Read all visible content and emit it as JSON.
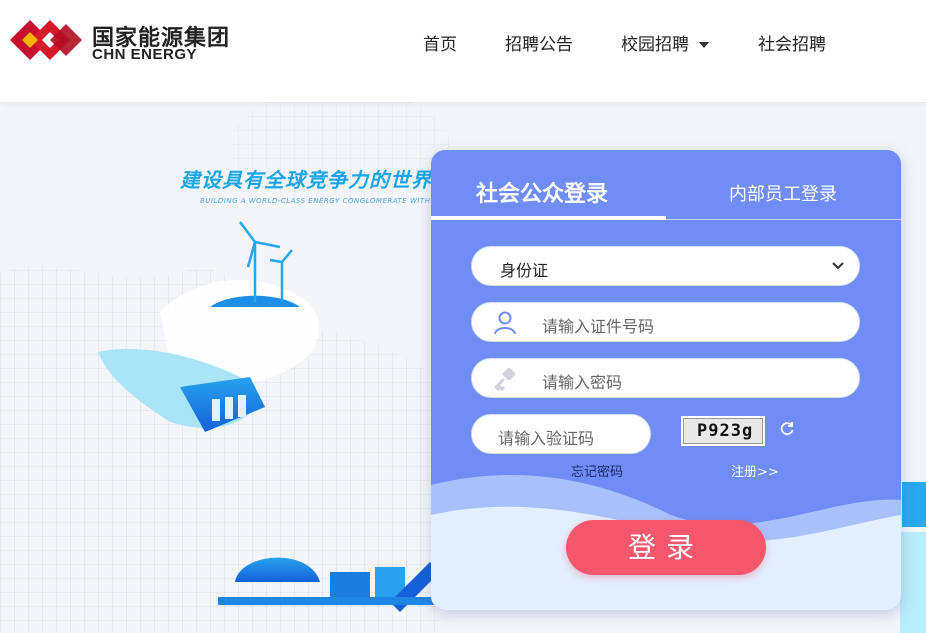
{
  "brand": {
    "name_cn": "国家能源集团",
    "name_en": "CHN ENERGY",
    "colors": {
      "primary_red": "#c8102e"
    }
  },
  "nav": {
    "items": [
      {
        "label": "首页"
      },
      {
        "label": "招聘公告"
      },
      {
        "label": "校园招聘",
        "has_dropdown": true
      },
      {
        "label": "社会招聘"
      }
    ]
  },
  "banner": {
    "slogan_cn": "建设具有全球竞争力的世界一流能",
    "slogan_en": "BUILDING A WORLD-CLASS ENERGY CONGLOMERATE WITH GLOBAL REA"
  },
  "login": {
    "tabs": [
      {
        "label": "社会公众登录",
        "active": true
      },
      {
        "label": "内部员工登录",
        "active": false
      }
    ],
    "id_type": {
      "selected": "身份证"
    },
    "id_number": {
      "placeholder": "请输入证件号码",
      "icon": "user-icon"
    },
    "password": {
      "placeholder": "请输入密码",
      "icon": "key-icon"
    },
    "captcha": {
      "placeholder": "请输入验证码",
      "image_text": "P923g"
    },
    "forgot_label": "忘记密码",
    "register_label": "注册>>",
    "submit_label": "登录",
    "colors": {
      "card_bg": "#6f8cf7",
      "button": "#f5576c"
    }
  }
}
